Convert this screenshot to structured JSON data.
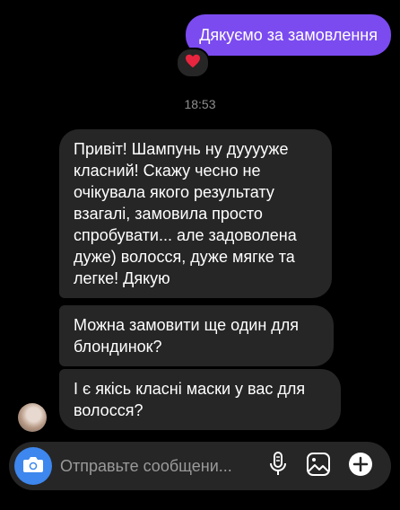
{
  "messages": {
    "sent": "Дякуємо за замовлення",
    "reaction": "❤️",
    "timestamp": "18:53",
    "received": [
      "Привіт! Шампунь ну дууууже класний! Скажу чесно не очікувала якого результату взагалі, замовила просто спробувати... але задоволена дуже) волосся, дуже мягке та легке! Дякую",
      "Можна замовити ще один для блондинок?",
      "І є якісь класні маски у вас для волосся?"
    ]
  },
  "composer": {
    "placeholder": "Отправьте сообщени...",
    "icons": [
      "camera-icon",
      "microphone-icon",
      "gallery-icon",
      "plus-icon"
    ]
  },
  "colors": {
    "sent_bubble": "#7b4bf0",
    "received_bubble": "#262626",
    "camera_button": "#3d87ee",
    "background": "#000000"
  }
}
